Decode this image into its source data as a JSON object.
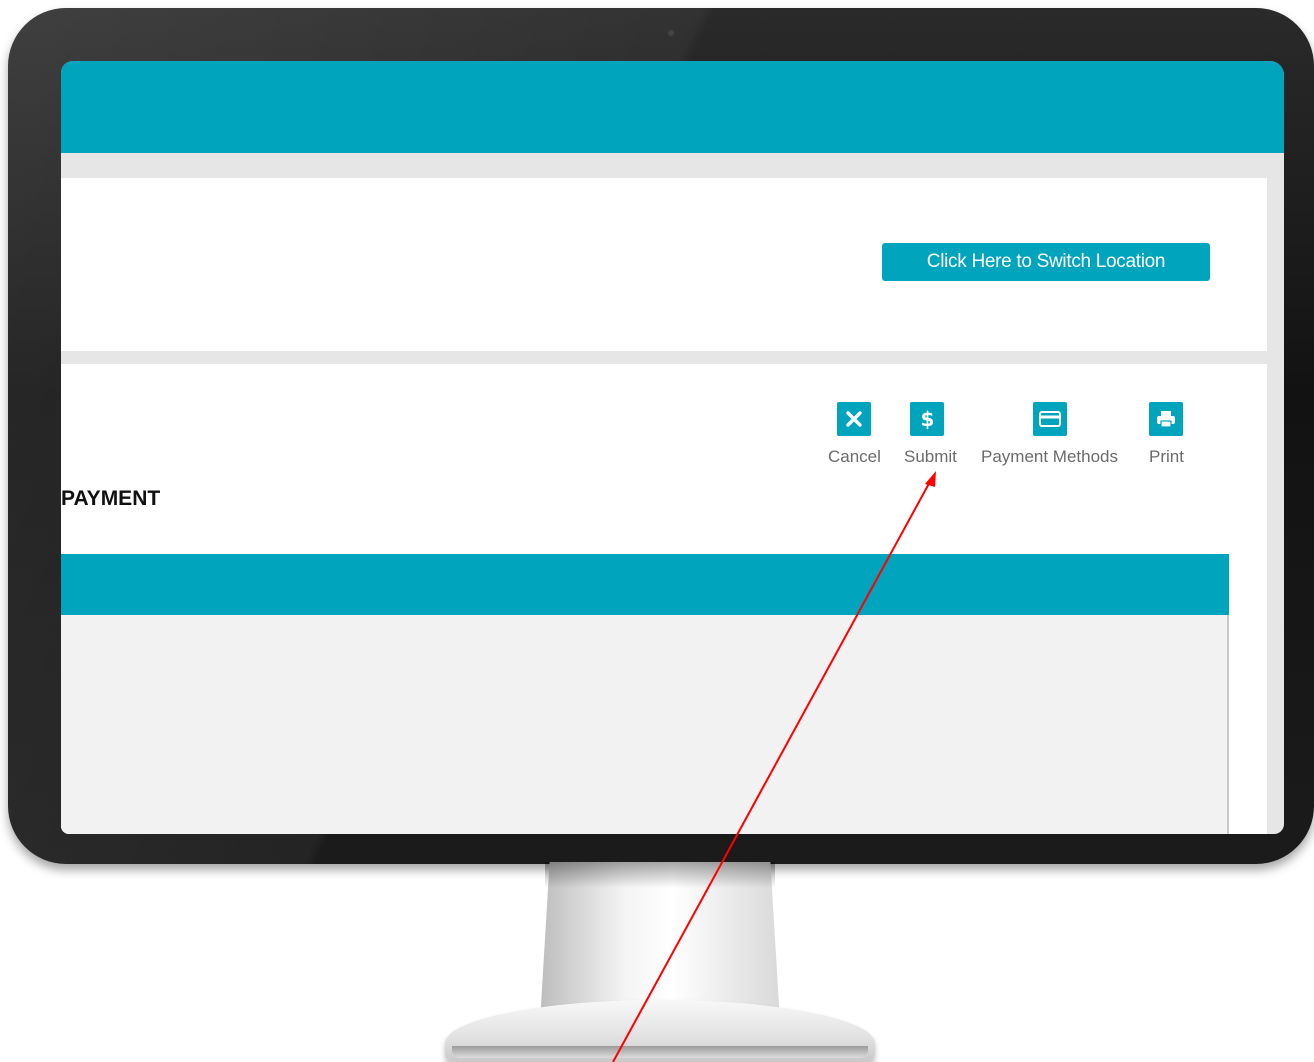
{
  "colors": {
    "accent": "#00a4bd",
    "panel_bg": "#ffffff",
    "page_bg": "#e6e6e6",
    "grid_body": "#f2f2f2",
    "annotation_arrow": "#ff0000"
  },
  "location": {
    "switch_button_label": "Click Here to Switch Location"
  },
  "toolbar": {
    "items": [
      {
        "label": "Cancel",
        "icon": "close-icon"
      },
      {
        "label": "Submit",
        "icon": "dollar-icon"
      },
      {
        "label": "Payment Methods",
        "icon": "credit-card-icon"
      },
      {
        "label": "Print",
        "icon": "printer-icon"
      }
    ]
  },
  "payment": {
    "section_title": "PAYMENT"
  }
}
